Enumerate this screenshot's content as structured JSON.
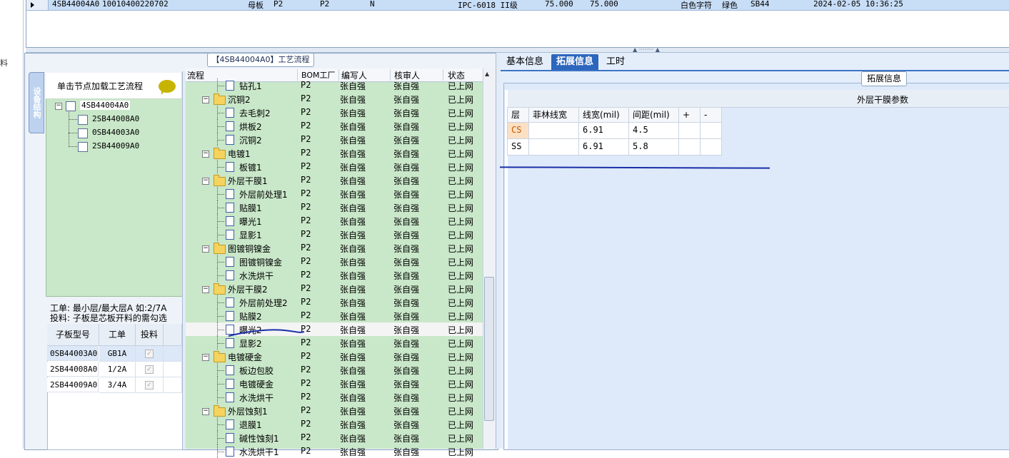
{
  "top_row": {
    "cells": [
      "4SB44004A0",
      "10010400220702",
      "母板",
      "P2",
      "P2",
      "N",
      "IPC-6018 II级",
      "75.000",
      "75.000",
      "白色字符",
      "绿色",
      "SB44",
      "2024-02-05 10:36:25"
    ]
  },
  "left_strip_label": "料",
  "left_group_title": "【4SB44004A0】工艺流程",
  "vertical_tab": "设备结构",
  "tree": {
    "header": "单击节点加载工艺流程",
    "root": "4SB44004A0",
    "children": [
      "2SB44008A0",
      "0SB44003A0",
      "2SB44009A0"
    ]
  },
  "info": {
    "line1": "工单: 最小层/最大层A 如:2/7A",
    "line2": "投料: 子板是芯板开料的需勾选"
  },
  "sub_table": {
    "headers": [
      "子板型号",
      "工单",
      "投料"
    ],
    "rows": [
      {
        "model": "0SB44003A0",
        "order": "GB1A",
        "checked": true
      },
      {
        "model": "2SB44008A0",
        "order": "1/2A",
        "checked": true
      },
      {
        "model": "2SB44009A0",
        "order": "3/4A",
        "checked": true
      }
    ]
  },
  "process": {
    "headers": [
      "流程",
      "BOM工厂",
      "编写人",
      "核审人",
      "状态"
    ],
    "rows": [
      {
        "name": "钻孔1",
        "level": 2,
        "bom": "P2",
        "writer": "张自强",
        "reviewer": "张自强",
        "status": "已上网"
      },
      {
        "name": "沉铜2",
        "level": 1,
        "bom": "P2",
        "writer": "张自强",
        "reviewer": "张自强",
        "status": "已上网"
      },
      {
        "name": "去毛刺2",
        "level": 2,
        "bom": "P2",
        "writer": "张自强",
        "reviewer": "张自强",
        "status": "已上网"
      },
      {
        "name": "烘板2",
        "level": 2,
        "bom": "P2",
        "writer": "张自强",
        "reviewer": "张自强",
        "status": "已上网"
      },
      {
        "name": "沉铜2",
        "level": 2,
        "bom": "P2",
        "writer": "张自强",
        "reviewer": "张自强",
        "status": "已上网"
      },
      {
        "name": "电镀1",
        "level": 1,
        "bom": "P2",
        "writer": "张自强",
        "reviewer": "张自强",
        "status": "已上网"
      },
      {
        "name": "板镀1",
        "level": 2,
        "bom": "P2",
        "writer": "张自强",
        "reviewer": "张自强",
        "status": "已上网"
      },
      {
        "name": "外层干膜1",
        "level": 1,
        "bom": "P2",
        "writer": "张自强",
        "reviewer": "张自强",
        "status": "已上网"
      },
      {
        "name": "外层前处理1",
        "level": 2,
        "bom": "P2",
        "writer": "张自强",
        "reviewer": "张自强",
        "status": "已上网"
      },
      {
        "name": "贴膜1",
        "level": 2,
        "bom": "P2",
        "writer": "张自强",
        "reviewer": "张自强",
        "status": "已上网"
      },
      {
        "name": "曝光1",
        "level": 2,
        "bom": "P2",
        "writer": "张自强",
        "reviewer": "张自强",
        "status": "已上网"
      },
      {
        "name": "显影1",
        "level": 2,
        "bom": "P2",
        "writer": "张自强",
        "reviewer": "张自强",
        "status": "已上网"
      },
      {
        "name": "图镀铜镍金",
        "level": 1,
        "bom": "P2",
        "writer": "张自强",
        "reviewer": "张自强",
        "status": "已上网"
      },
      {
        "name": "图镀铜镍金",
        "level": 2,
        "bom": "P2",
        "writer": "张自强",
        "reviewer": "张自强",
        "status": "已上网"
      },
      {
        "name": "水洗烘干",
        "level": 2,
        "bom": "P2",
        "writer": "张自强",
        "reviewer": "张自强",
        "status": "已上网"
      },
      {
        "name": "外层干膜2",
        "level": 1,
        "bom": "P2",
        "writer": "张自强",
        "reviewer": "张自强",
        "status": "已上网"
      },
      {
        "name": "外层前处理2",
        "level": 2,
        "bom": "P2",
        "writer": "张自强",
        "reviewer": "张自强",
        "status": "已上网"
      },
      {
        "name": "贴膜2",
        "level": 2,
        "bom": "P2",
        "writer": "张自强",
        "reviewer": "张自强",
        "status": "已上网"
      },
      {
        "name": "曝光2",
        "level": 2,
        "bom": "P2",
        "writer": "张自强",
        "reviewer": "张自强",
        "status": "已上网",
        "selected": true
      },
      {
        "name": "显影2",
        "level": 2,
        "bom": "P2",
        "writer": "张自强",
        "reviewer": "张自强",
        "status": "已上网"
      },
      {
        "name": "电镀硬金",
        "level": 1,
        "bom": "P2",
        "writer": "张自强",
        "reviewer": "张自强",
        "status": "已上网"
      },
      {
        "name": "板边包胶",
        "level": 2,
        "bom": "P2",
        "writer": "张自强",
        "reviewer": "张自强",
        "status": "已上网"
      },
      {
        "name": "电镀硬金",
        "level": 2,
        "bom": "P2",
        "writer": "张自强",
        "reviewer": "张自强",
        "status": "已上网"
      },
      {
        "name": "水洗烘干",
        "level": 2,
        "bom": "P2",
        "writer": "张自强",
        "reviewer": "张自强",
        "status": "已上网"
      },
      {
        "name": "外层蚀刻1",
        "level": 1,
        "bom": "P2",
        "writer": "张自强",
        "reviewer": "张自强",
        "status": "已上网"
      },
      {
        "name": "退膜1",
        "level": 2,
        "bom": "P2",
        "writer": "张自强",
        "reviewer": "张自强",
        "status": "已上网"
      },
      {
        "name": "碱性蚀刻1",
        "level": 2,
        "bom": "P2",
        "writer": "张自强",
        "reviewer": "张自强",
        "status": "已上网"
      },
      {
        "name": "水洗烘干1",
        "level": 2,
        "bom": "P2",
        "writer": "张自强",
        "reviewer": "张自强",
        "status": "已上网"
      }
    ]
  },
  "tabs": [
    {
      "label": "基本信息",
      "active": false
    },
    {
      "label": "拓展信息",
      "active": true
    },
    {
      "label": "工时",
      "active": false
    }
  ],
  "ext_title": "拓展信息",
  "param_table": {
    "title": "外层干膜参数",
    "headers": [
      "层",
      "菲林线宽",
      "线宽(mil)",
      "间距(mil)",
      "+",
      "-"
    ],
    "rows": [
      {
        "layer": "CS",
        "film": "",
        "width": "6.91",
        "spacing": "4.5",
        "highlight": true
      },
      {
        "layer": "SS",
        "film": "",
        "width": "6.91",
        "spacing": "5.8",
        "highlight": false
      }
    ]
  },
  "colors": {
    "tree_bg": "#c9e7c9",
    "tab_active": "#2c66bd",
    "annotation": "#1a2ea8"
  }
}
